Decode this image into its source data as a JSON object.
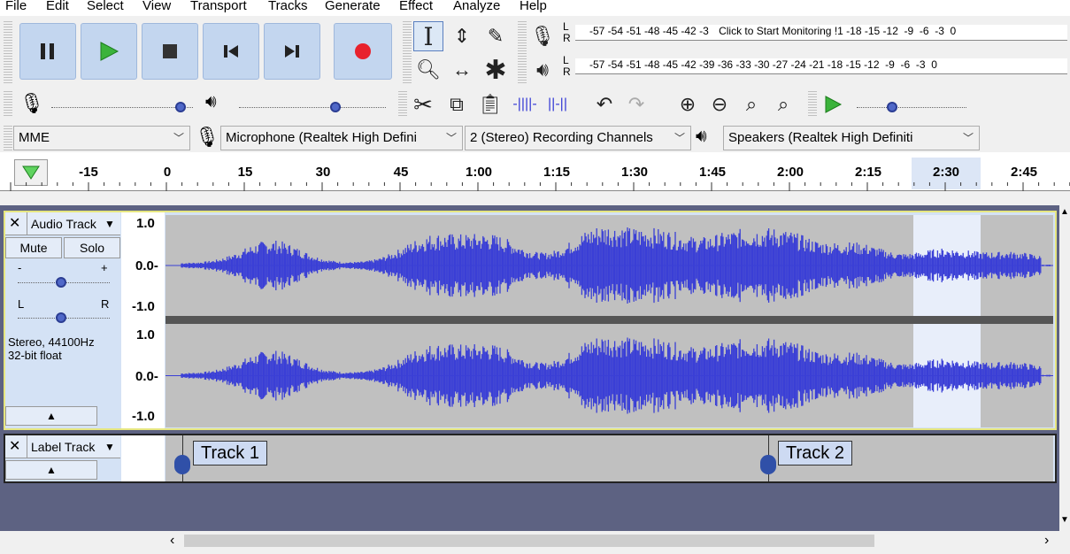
{
  "menu": [
    "File",
    "Edit",
    "Select",
    "View",
    "Transport",
    "Tracks",
    "Generate",
    "Effect",
    "Analyze",
    "Help"
  ],
  "transport": {
    "pause": "pause-icon",
    "play": "play-icon",
    "stop": "stop-icon",
    "skip_start": "skip-start-icon",
    "skip_end": "skip-end-icon",
    "record": "record-icon"
  },
  "meters": {
    "record_scale": "-57 -54 -51 -48 -45 -42 -3",
    "record_prompt": "Click to Start Monitoring",
    "record_scale_end": "!1 -18 -15 -12  -9  -6  -3  0",
    "play_scale": "-57 -54 -51 -48 -45 -42 -39 -36 -33 -30 -27 -24 -21 -18 -15 -12  -9  -6  -3  0",
    "L": "L",
    "R": "R"
  },
  "devices": {
    "host": "MME",
    "mic": "Microphone (Realtek High Defini",
    "channels": "2 (Stereo) Recording Channels",
    "speakers": "Speakers (Realtek High Definiti"
  },
  "ruler": {
    "ticks": [
      "-15",
      "0",
      "15",
      "30",
      "45",
      "1:00",
      "1:15",
      "1:30",
      "1:45",
      "2:00",
      "2:15",
      "2:30",
      "2:45"
    ]
  },
  "audio_track": {
    "name": "Audio Track",
    "mute": "Mute",
    "solo": "Solo",
    "gain_minus": "-",
    "gain_plus": "+",
    "pan_l": "L",
    "pan_r": "R",
    "format_line1": "Stereo, 44100Hz",
    "format_line2": "32-bit float",
    "scale_top": "1.0",
    "scale_mid": "0.0-",
    "scale_bot": "-1.0"
  },
  "label_track": {
    "name": "Label Track",
    "labels": [
      "Track 1",
      "Track 2"
    ]
  },
  "colors": {
    "wave": "#3a3fd6",
    "selection": "#e8eefa",
    "track_bg": "#c0c0c0",
    "empty_area": "#5d6282"
  }
}
